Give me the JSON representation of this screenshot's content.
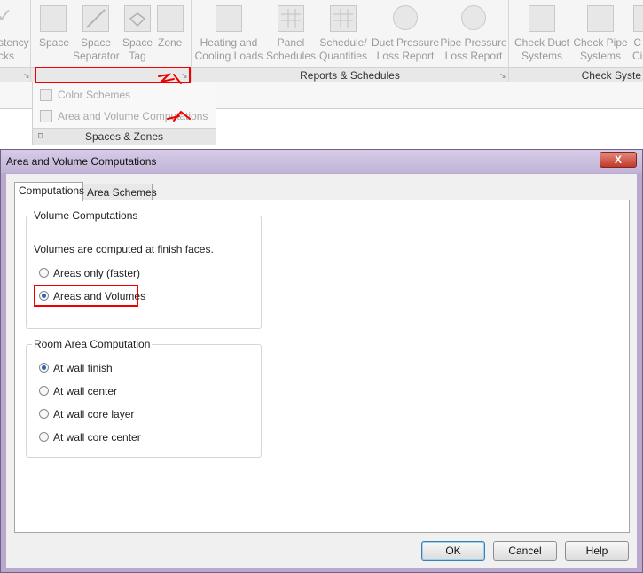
{
  "ribbon": {
    "buttons": [
      {
        "label": "stency\ncks",
        "icon": "consistency-check-icon"
      },
      {
        "label": "Space",
        "icon": "space-icon"
      },
      {
        "label": "Space\nSeparator",
        "icon": "space-separator-icon"
      },
      {
        "label": "Space\nTag",
        "icon": "space-tag-icon"
      },
      {
        "label": "Zone",
        "icon": "zone-icon"
      },
      {
        "label": "Heating and\nCooling Loads",
        "icon": "heating-cooling-icon"
      },
      {
        "label": "Panel\nSchedules",
        "icon": "panel-schedules-icon"
      },
      {
        "label": "Schedule/\nQuantities",
        "icon": "schedule-quantities-icon"
      },
      {
        "label": "Duct Pressure\nLoss Report",
        "icon": "duct-pressure-icon"
      },
      {
        "label": "Pipe Pressure\nLoss Report",
        "icon": "pipe-pressure-icon"
      },
      {
        "label": "Check Duct\nSystems",
        "icon": "check-duct-icon"
      },
      {
        "label": "Check Pipe\nSystems",
        "icon": "check-pipe-icon"
      },
      {
        "label": "C\nCi",
        "icon": "check-circuits-icon"
      }
    ],
    "panels": {
      "reports": "Reports & Schedules",
      "check": "Check Syste"
    },
    "dropdown": {
      "items": [
        "Color Schemes",
        "Area and Volume Computations"
      ],
      "panel_label": "Spaces & Zones"
    }
  },
  "dialog": {
    "title": "Area and Volume Computations",
    "close": "X",
    "tabs": [
      "Computations",
      "Area Schemes"
    ],
    "volume_group": {
      "label": "Volume Computations",
      "note": "Volumes are computed at finish faces.",
      "options": [
        "Areas only (faster)",
        "Areas and Volumes"
      ],
      "selected": 1
    },
    "room_group": {
      "label": "Room Area Computation",
      "options": [
        "At wall finish",
        "At wall center",
        "At wall core layer",
        "At wall core center"
      ],
      "selected": 0
    },
    "buttons": {
      "ok": "OK",
      "cancel": "Cancel",
      "help": "Help"
    }
  },
  "colors": {
    "annotation": "#e00000",
    "dialog_frame": "#b9a9cf",
    "radio_selected": "#2a62b8"
  }
}
